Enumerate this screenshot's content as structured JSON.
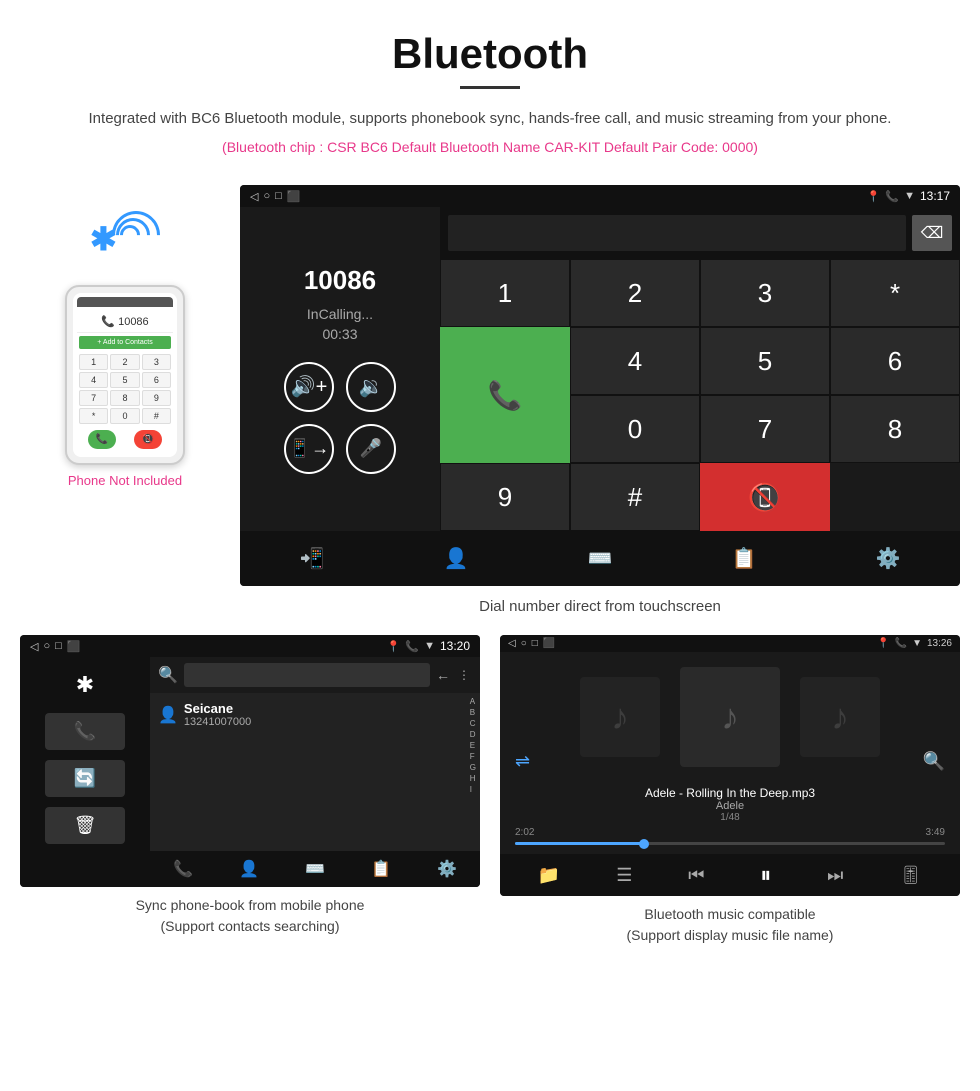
{
  "header": {
    "title": "Bluetooth",
    "description": "Integrated with BC6 Bluetooth module, supports phonebook sync, hands-free call, and music streaming from your phone.",
    "chip_info": "(Bluetooth chip : CSR BC6    Default Bluetooth Name CAR-KIT    Default Pair Code: 0000)"
  },
  "top_screen": {
    "status_bar": {
      "nav_icons": [
        "◁",
        "○",
        "□",
        "⬛"
      ],
      "right_icons": [
        "📍",
        "📞",
        "▼",
        "13:17"
      ]
    },
    "calling": {
      "number": "10086",
      "status": "InCalling...",
      "timer": "00:33"
    },
    "caption": "Dial number direct from touchscreen"
  },
  "phone_illustration": {
    "label": "Phone Not Included"
  },
  "bottom_left": {
    "screen": {
      "contact_name": "Seicane",
      "contact_number": "13241007000",
      "status_time": "13:20"
    },
    "caption_line1": "Sync phone-book from mobile phone",
    "caption_line2": "(Support contacts searching)"
  },
  "bottom_right": {
    "screen": {
      "song_name": "Adele - Rolling In the Deep.mp3",
      "artist": "Adele",
      "track": "1/48",
      "current_time": "2:02",
      "total_time": "3:49",
      "status_time": "13:26"
    },
    "caption_line1": "Bluetooth music compatible",
    "caption_line2": "(Support display music file name)"
  },
  "keypad": {
    "keys": [
      "1",
      "2",
      "3",
      "*",
      "4",
      "5",
      "6",
      "0",
      "7",
      "8",
      "9",
      "#"
    ]
  },
  "alphabet": [
    "A",
    "B",
    "C",
    "D",
    "E",
    "F",
    "G",
    "H",
    "I"
  ]
}
